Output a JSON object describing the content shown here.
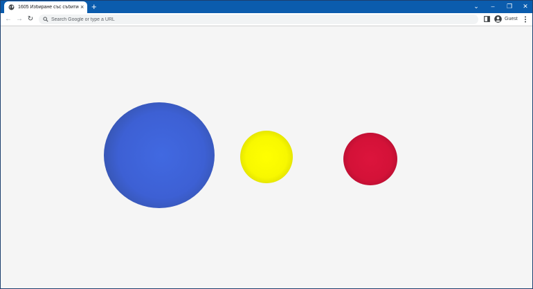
{
  "browser": {
    "tab": {
      "title": "1605 Избиране със събитие.html",
      "close_label": "×",
      "favicon_icon": "globe-icon"
    },
    "new_tab_label": "+",
    "window_controls": {
      "dropdown_label": "⌄",
      "minimize_label": "–",
      "restore_label": "❐",
      "close_label": "✕"
    },
    "toolbar": {
      "back_label": "←",
      "forward_label": "→",
      "reload_label": "↻",
      "address_placeholder": "Search Google or type a URL",
      "address_value": "",
      "profile_label": "Guest"
    },
    "colors": {
      "titlebar": "#0b5cad",
      "page_background": "#f5f5f5"
    }
  },
  "page": {
    "balls": [
      {
        "name": "blue-ball",
        "color": "#4169e1"
      },
      {
        "name": "yellow-ball",
        "color": "#ffff00"
      },
      {
        "name": "red-ball",
        "color": "#dc143c"
      }
    ]
  }
}
